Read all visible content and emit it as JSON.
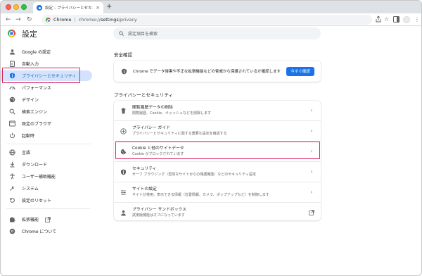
{
  "browser": {
    "tab_title": "設定 – プライバシーとセキュリティ",
    "tab_close": "×",
    "new_tab": "+",
    "nav": {
      "back": "←",
      "forward": "→",
      "reload": "↻"
    },
    "url": {
      "host": "Chrome",
      "separator": "|",
      "scheme": "chrome://",
      "path_bold": "settings",
      "path_rest": "/privacy"
    },
    "toolbar_icons": [
      "share-icon",
      "star-icon",
      "sidepanel-icon",
      "profile-avatar",
      "menu-icon"
    ]
  },
  "header": {
    "title": "設定",
    "search_placeholder": "設定項目を検索"
  },
  "sidebar": {
    "items": [
      {
        "label": "Google の設定",
        "icon": "person-icon"
      },
      {
        "label": "自動入力",
        "icon": "clipboard-icon"
      },
      {
        "label": "プライバシーとセキュリティ",
        "icon": "shield-icon",
        "active": true
      },
      {
        "label": "パフォーマンス",
        "icon": "speedometer-icon"
      },
      {
        "label": "デザイン",
        "icon": "palette-icon"
      },
      {
        "label": "検索エンジン",
        "icon": "search-icon"
      },
      {
        "label": "既定のブラウザ",
        "icon": "browser-icon"
      },
      {
        "label": "起動時",
        "icon": "power-icon"
      },
      {
        "label": "言語",
        "icon": "globe-icon"
      },
      {
        "label": "ダウンロード",
        "icon": "download-icon"
      },
      {
        "label": "ユーザー補助機能",
        "icon": "accessibility-icon"
      },
      {
        "label": "システム",
        "icon": "wrench-icon"
      },
      {
        "label": "設定のリセット",
        "icon": "reset-icon"
      },
      {
        "label": "拡張機能",
        "icon": "puzzle-icon"
      },
      {
        "label": "Chrome について",
        "icon": "chrome-icon"
      }
    ]
  },
  "safety_check": {
    "section_title": "安全確認",
    "text": "Chrome でデータ侵害や不正な拡張機能などの脅威から保護されているか確認します",
    "button": "今すぐ確認"
  },
  "privacy": {
    "section_title": "プライバシーとセキュリティ",
    "rows": [
      {
        "title": "閲覧履歴データの削除",
        "subtitle": "閲覧履歴、Cookie、キャッシュなどを削除します",
        "icon": "trash-icon",
        "action": "chevron"
      },
      {
        "title": "プライバシー ガイド",
        "subtitle": "プライバシーとセキュリティに関する重要な設定を確認する",
        "icon": "compass-icon",
        "action": "chevron"
      },
      {
        "title": "Cookie と他のサイトデータ",
        "subtitle": "Cookie がブロックされています",
        "icon": "cookie-icon",
        "action": "chevron",
        "highlighted": true
      },
      {
        "title": "セキュリティ",
        "subtitle": "セーフ ブラウジング（危険なサイトからの保護機能）などのセキュリティ設定",
        "icon": "shield-icon",
        "action": "chevron"
      },
      {
        "title": "サイトの設定",
        "subtitle": "サイトが使用、表示できる情報（位置情報、カメラ、ポップアップなど）を制御します",
        "icon": "sliders-icon",
        "action": "chevron"
      },
      {
        "title": "プライバシー サンドボックス",
        "subtitle": "試用版機能はオフになっています",
        "icon": "flask-icon",
        "action": "external"
      }
    ]
  },
  "colors": {
    "accent": "#1a73e8",
    "highlight_border": "#d6225a",
    "active_bg": "#d3e3fd"
  }
}
